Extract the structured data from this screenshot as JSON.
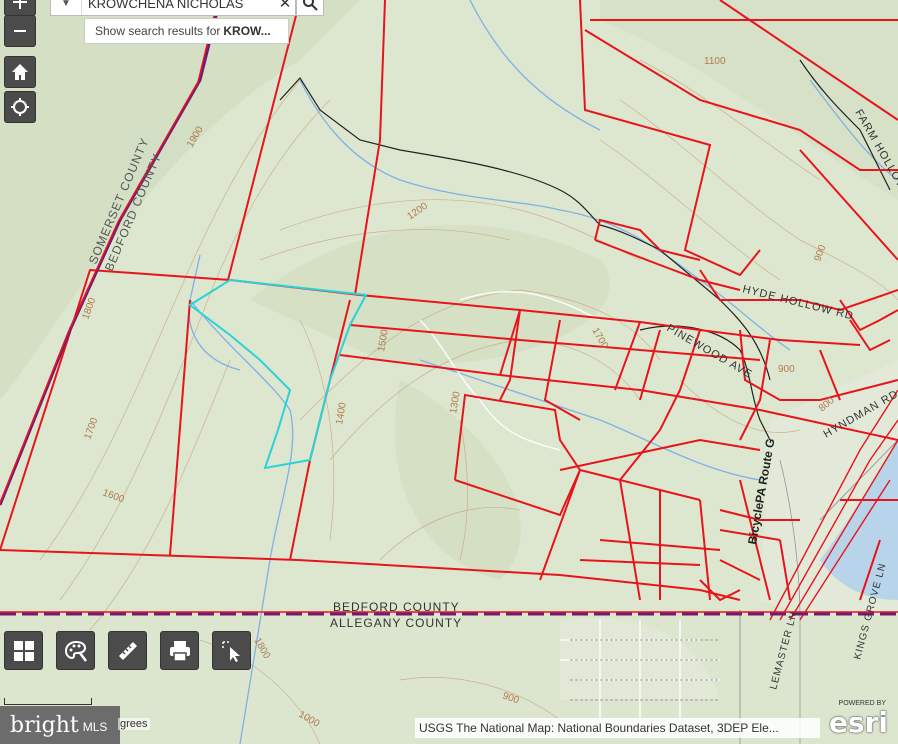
{
  "search": {
    "value": "KROWCHENA NICHOLAS",
    "suggestion_prefix": "Show search results for",
    "suggestion_term": "KROW..."
  },
  "map_labels": {
    "somerset_county": "SOMERSET COUNTY",
    "bedford_county_diag": "BEDFORD COUNTY",
    "bedford_county": "BEDFORD COUNTY",
    "allegany_county": "ALLEGANY COUNTY",
    "farm_hollow": "FARM HOLLOW",
    "hyde_hollow_rd": "HYDE HOLLOW RD",
    "pinewood_ave": "PINEWOOD AVE",
    "hyndman_rd": "HYNDMAN RD",
    "bicycle_route": "BicyclePA Route G",
    "lemaster_ln": "LEMASTER LN",
    "kings_grove": "KINGS GROVE LN",
    "c1900": "1900",
    "c1800a": "1800",
    "c1700": "1700",
    "c1600": "1600",
    "c1200": "1200",
    "c1100": "1100",
    "c900a": "900",
    "c900b": "900",
    "c800": "800",
    "c1500": "1500",
    "c1400": "1400",
    "c1300": "1300",
    "c1000": "1000",
    "c1800b": "1800",
    "c1700b": "1700",
    "c900c": "900"
  },
  "scale": {
    "text": "grees"
  },
  "attribution": {
    "text": "USGS The National Map: National Boundaries Dataset, 3DEP Ele..."
  },
  "logo": {
    "brand": "bright",
    "suffix": "MLS"
  },
  "esri": {
    "powered": "POWERED BY",
    "name": "esri"
  },
  "colors": {
    "terrain": "#dfe8d2",
    "parcel_line": "#e8141c",
    "selected_parcel": "#29d3d8",
    "county_boundary": "#6a1e7a",
    "stream": "#7fb0e8",
    "contour": "#c9a27c",
    "road": "#222222",
    "control_bg": "#4b4b4b"
  },
  "icons": {
    "zoom_in": "plus-icon",
    "zoom_out": "minus-icon",
    "home": "home-icon",
    "locate": "crosshair-icon",
    "basemap_gallery": "grid-icon",
    "draw": "palette-icon",
    "measure": "ruler-icon",
    "print": "printer-icon",
    "select": "select-cursor-icon",
    "search": "search-icon",
    "clear": "close-icon",
    "dropdown": "chevron-down-icon"
  }
}
